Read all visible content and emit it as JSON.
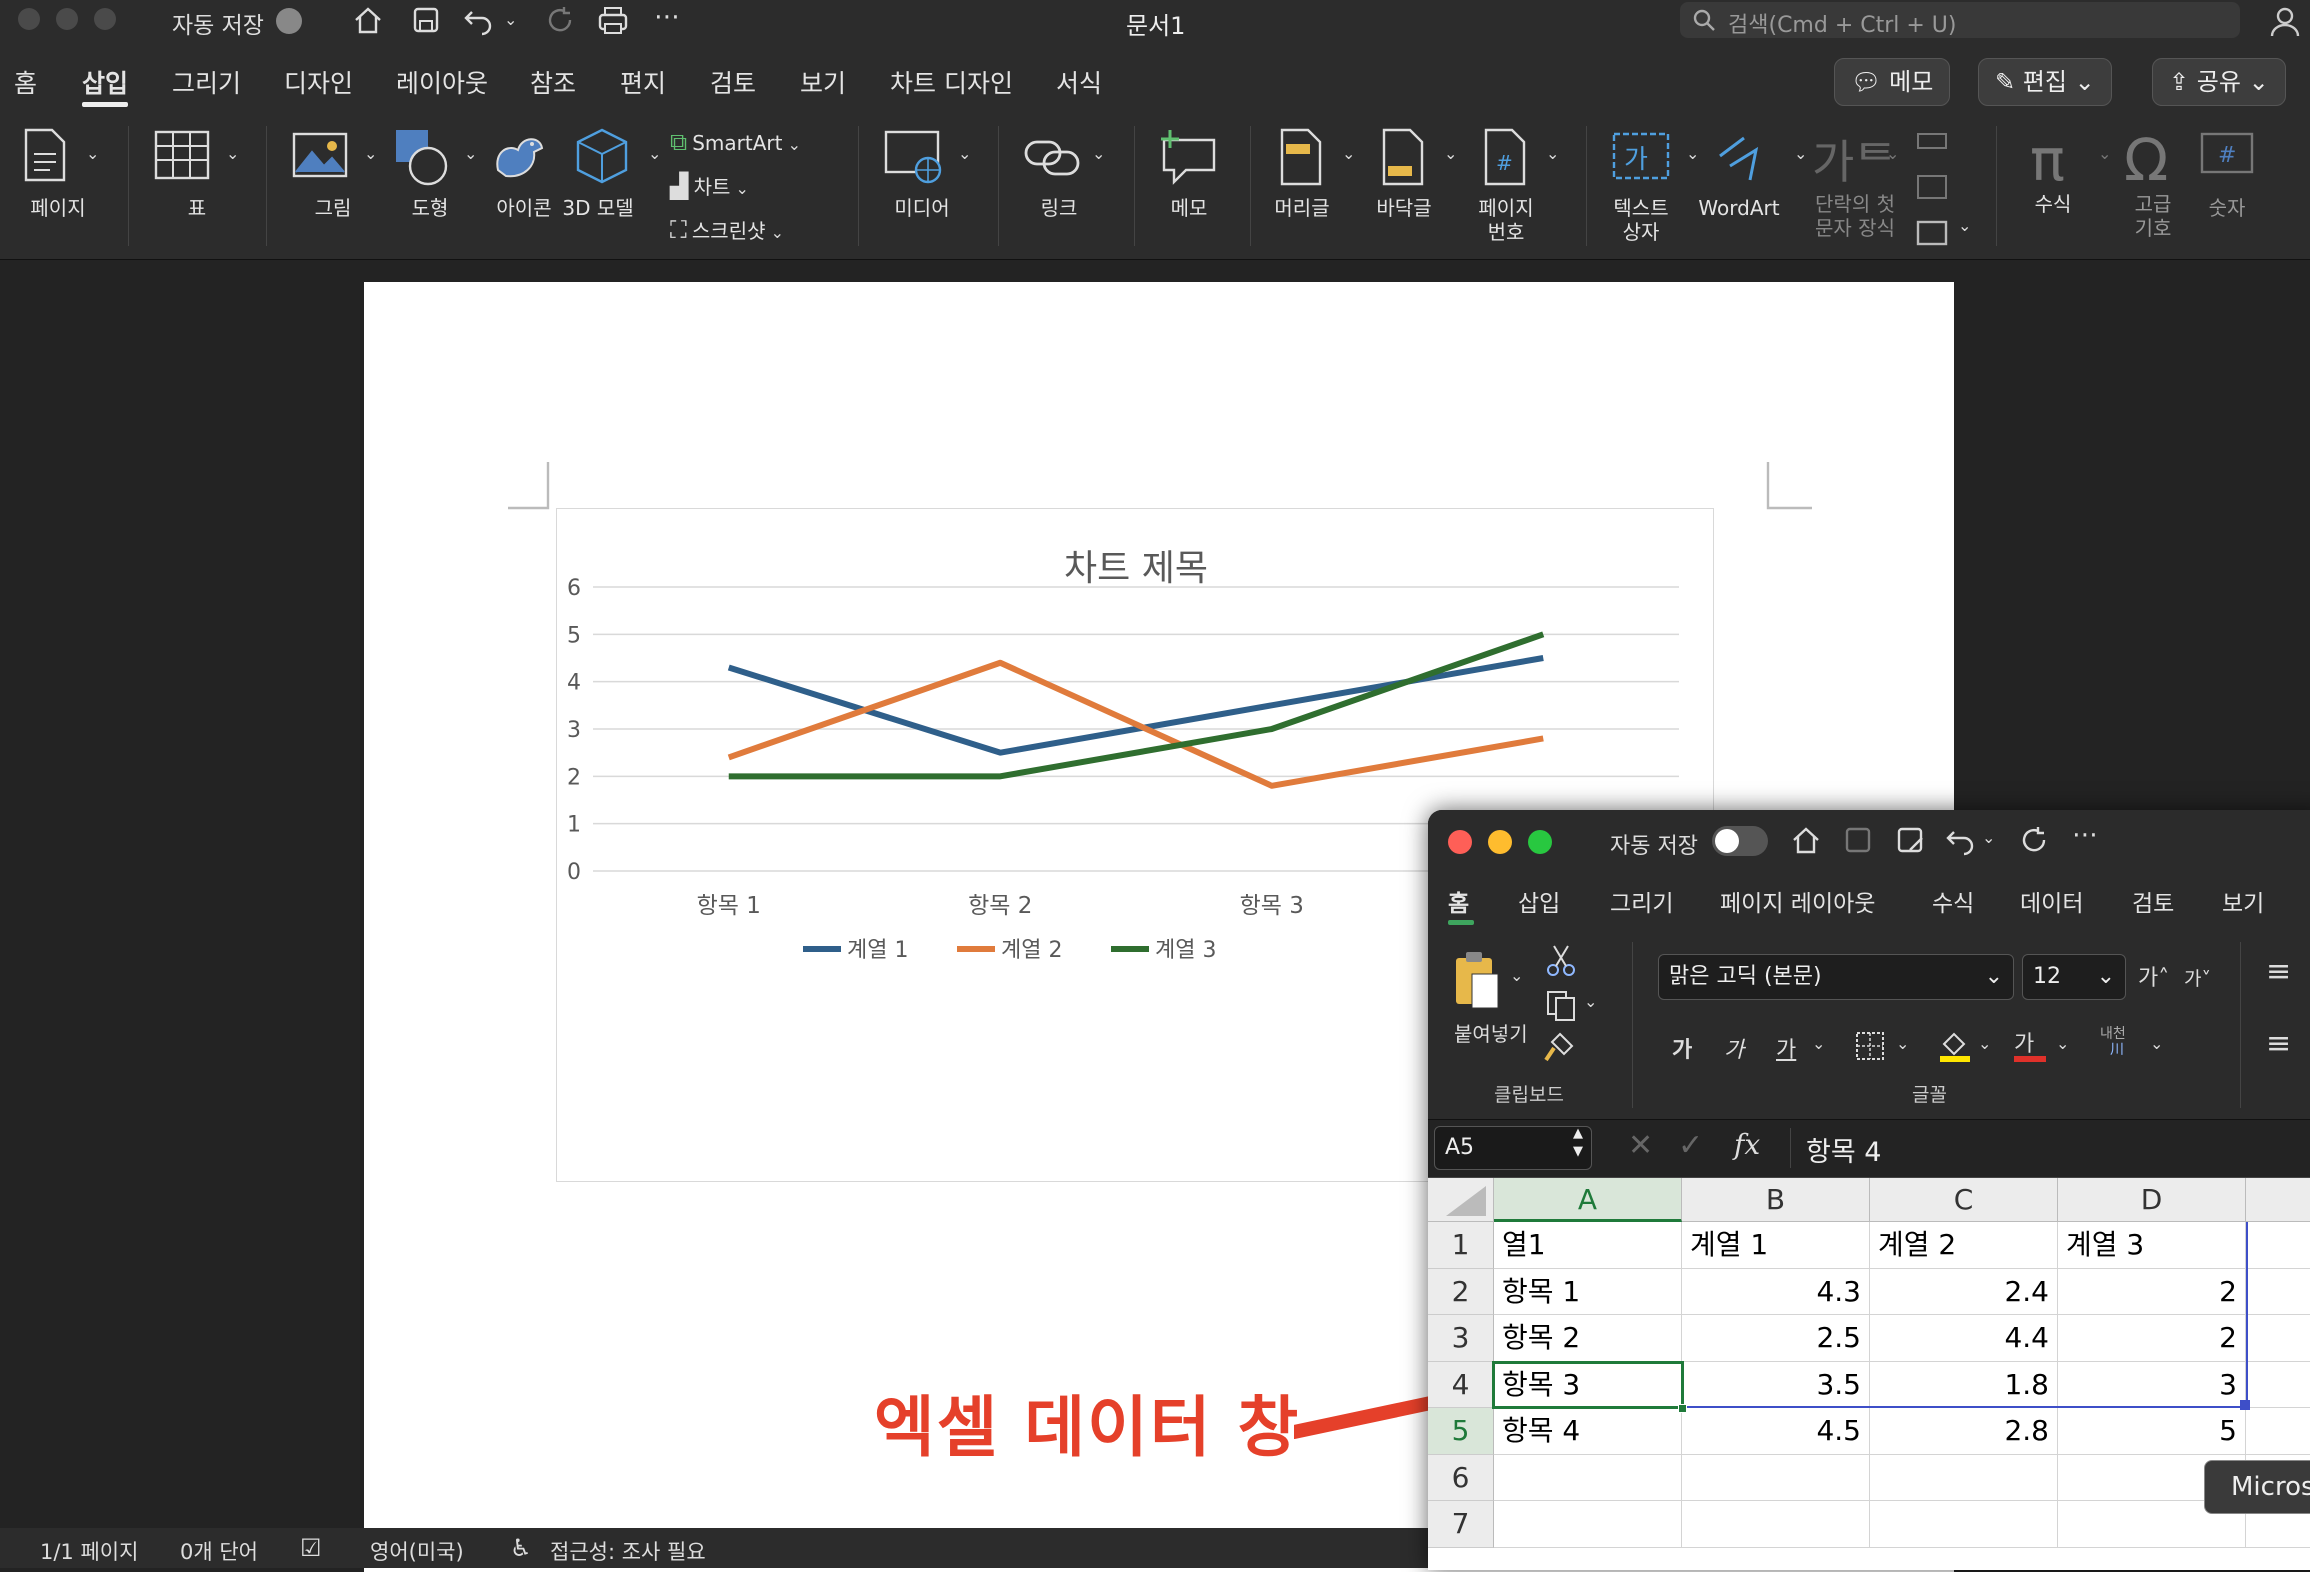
{
  "word": {
    "title": "문서1",
    "autosave_label": "자동 저장",
    "search_placeholder": "검색(Cmd + Ctrl + U)",
    "tabs": [
      "홈",
      "삽입",
      "그리기",
      "디자인",
      "레이아웃",
      "참조",
      "편지",
      "검토",
      "보기",
      "차트 디자인",
      "서식"
    ],
    "memo_button": "메모",
    "edit_button": "편집",
    "share_button": "공유",
    "ribbon": {
      "page": "페이지",
      "table": "표",
      "picture": "그림",
      "shape": "도형",
      "icon": "아이콘",
      "model3d": "3D 모델",
      "smartart": "SmartArt",
      "chart": "차트",
      "screenshot": "스크린샷",
      "media": "미디어",
      "link": "링크",
      "comment": "메모",
      "header": "머리글",
      "footer": "바닥글",
      "pagenum1": "페이지",
      "pagenum2": "번호",
      "textbox1": "텍스트",
      "textbox2": "상자",
      "wordart": "WordArt",
      "dropcap1": "단락의 첫",
      "dropcap2": "문자 장식",
      "equation": "수식",
      "symbol1": "고급",
      "symbol2": "기호",
      "number": "숫자"
    },
    "status": {
      "page": "1/1 페이지",
      "words": "0개 단어",
      "lang": "영어(미국)",
      "access": "접근성: 조사 필요"
    }
  },
  "chart_data": {
    "type": "line",
    "title": "차트 제목",
    "categories": [
      "항목 1",
      "항목 2",
      "항목 3",
      "항목 4"
    ],
    "series": [
      {
        "name": "계열 1",
        "values": [
          4.3,
          2.5,
          3.5,
          4.5
        ],
        "color": "#2f5f8a"
      },
      {
        "name": "계열 2",
        "values": [
          2.4,
          4.4,
          1.8,
          2.8
        ],
        "color": "#e07b3c"
      },
      {
        "name": "계열 3",
        "values": [
          2,
          2,
          3,
          5
        ],
        "color": "#2f6e2f"
      }
    ],
    "ylim": [
      0,
      6
    ],
    "yticks": [
      "0",
      "1",
      "2",
      "3",
      "4",
      "5",
      "6"
    ],
    "grid": true,
    "legend": "bottom"
  },
  "excel": {
    "autosave_label": "자동 저장",
    "tabs": [
      "홈",
      "삽입",
      "그리기",
      "페이지 레이아웃",
      "수식",
      "데이터",
      "검토",
      "보기"
    ],
    "paste_label": "붙여넣기",
    "clipboard_label": "클립보드",
    "font_group_label": "글꼴",
    "font_name": "맑은 고딕 (본문)",
    "font_size": "12",
    "cell_ref": "A5",
    "formula": "항목 4",
    "columns": [
      "A",
      "B",
      "C",
      "D"
    ],
    "rows": [
      "1",
      "2",
      "3",
      "4",
      "5",
      "6",
      "7"
    ],
    "cells": [
      [
        "열1",
        "계열 1",
        "계열 2",
        "계열 3"
      ],
      [
        "항목 1",
        "4.3",
        "2.4",
        "2"
      ],
      [
        "항목 2",
        "2.5",
        "4.4",
        "2"
      ],
      [
        "항목 3",
        "3.5",
        "1.8",
        "3"
      ],
      [
        "항목 4",
        "4.5",
        "2.8",
        "5"
      ]
    ],
    "tooltip": "Micros"
  },
  "annotation": "엑셀 데이터 창"
}
